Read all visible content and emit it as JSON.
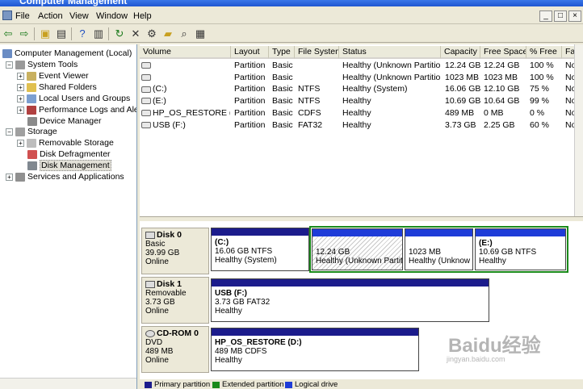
{
  "window": {
    "title": "Computer Management"
  },
  "menu": [
    "File",
    "Action",
    "View",
    "Window",
    "Help"
  ],
  "window_controls": [
    "_",
    "□",
    "×"
  ],
  "toolbar_icons": [
    "back-icon",
    "forward-icon",
    "up-folder-icon",
    "show-tree-icon",
    "help-icon",
    "properties-icon",
    "refresh-icon",
    "delete-icon",
    "settings-icon",
    "open-icon",
    "search-icon",
    "export-icon"
  ],
  "tree": {
    "root": "Computer Management (Local)",
    "system_tools": "System Tools",
    "event_viewer": "Event Viewer",
    "shared_folders": "Shared Folders",
    "local_users": "Local Users and Groups",
    "perf_logs": "Performance Logs and Alerts",
    "device_manager": "Device Manager",
    "storage": "Storage",
    "removable_storage": "Removable Storage",
    "disk_defrag": "Disk Defragmenter",
    "disk_management": "Disk Management",
    "services": "Services and Applications"
  },
  "columns": [
    "Volume",
    "Layout",
    "Type",
    "File System",
    "Status",
    "Capacity",
    "Free Space",
    "% Free",
    "Fault"
  ],
  "volumes": [
    {
      "volume": "",
      "layout": "Partition",
      "type": "Basic",
      "fs": "",
      "status": "Healthy (Unknown Partition)",
      "capacity": "12.24 GB",
      "free": "12.24 GB",
      "pct": "100 %",
      "fault": "No"
    },
    {
      "volume": "",
      "layout": "Partition",
      "type": "Basic",
      "fs": "",
      "status": "Healthy (Unknown Partition)",
      "capacity": "1023 MB",
      "free": "1023 MB",
      "pct": "100 %",
      "fault": "No"
    },
    {
      "volume": "(C:)",
      "layout": "Partition",
      "type": "Basic",
      "fs": "NTFS",
      "status": "Healthy (System)",
      "capacity": "16.06 GB",
      "free": "12.10 GB",
      "pct": "75 %",
      "fault": "No"
    },
    {
      "volume": "(E:)",
      "layout": "Partition",
      "type": "Basic",
      "fs": "NTFS",
      "status": "Healthy",
      "capacity": "10.69 GB",
      "free": "10.64 GB",
      "pct": "99 %",
      "fault": "No"
    },
    {
      "volume": "HP_OS_RESTORE (D:)",
      "layout": "Partition",
      "type": "Basic",
      "fs": "CDFS",
      "status": "Healthy",
      "capacity": "489 MB",
      "free": "0 MB",
      "pct": "0 %",
      "fault": "No"
    },
    {
      "volume": "USB (F:)",
      "layout": "Partition",
      "type": "Basic",
      "fs": "FAT32",
      "status": "Healthy",
      "capacity": "3.73 GB",
      "free": "2.25 GB",
      "pct": "60 %",
      "fault": "No"
    }
  ],
  "disks": [
    {
      "name": "Disk 0",
      "kind": "Basic",
      "size": "39.99 GB",
      "state": "Online",
      "partitions": [
        {
          "title": "(C:)",
          "line1": "16.06 GB NTFS",
          "line2": "Healthy (System)"
        },
        {
          "title": "",
          "line1": "12.24 GB",
          "line2": "Healthy (Unknown Partit"
        },
        {
          "title": "",
          "line1": "1023 MB",
          "line2": "Healthy (Unknow"
        },
        {
          "title": "(E:)",
          "line1": "10.69 GB NTFS",
          "line2": "Healthy"
        }
      ]
    },
    {
      "name": "Disk 1",
      "kind": "Removable",
      "size": "3.73 GB",
      "state": "Online",
      "partitions": [
        {
          "title": "USB (F:)",
          "line1": "3.73 GB FAT32",
          "line2": "Healthy"
        }
      ]
    },
    {
      "name": "CD-ROM 0",
      "kind": "DVD",
      "size": "489 MB",
      "state": "Online",
      "partitions": [
        {
          "title": "HP_OS_RESTORE (D:)",
          "line1": "489 MB CDFS",
          "line2": "Healthy"
        }
      ]
    }
  ],
  "legend": [
    "Primary partition",
    "Extended partition",
    "Logical drive"
  ],
  "colors": {
    "primary": "#1c1c8c",
    "extended": "#1a8a1a",
    "logical": "#1e3cd8"
  },
  "watermark": {
    "brand": "Baidu经验",
    "url": "jingyan.baidu.com"
  }
}
